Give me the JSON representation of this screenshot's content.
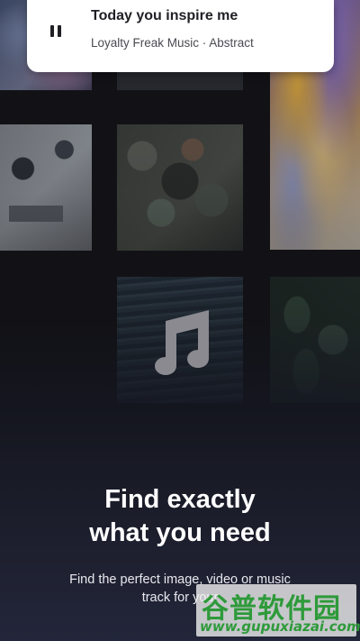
{
  "now_playing": {
    "title": "Today you inspire me",
    "subtitle": "Loyalty Freak Music · Abstract",
    "control_icon": "pause-icon"
  },
  "onboarding": {
    "headline_line1": "Find exactly",
    "headline_line2": "what you need",
    "description_line1": "Find the perfect image, video or music",
    "description_line2": "track for your"
  },
  "center_icon": "music-note-icon",
  "watermark": {
    "chinese_text": "谷普软件园",
    "url": "www.gupuxiazai.com"
  },
  "colors": {
    "background": "#121216",
    "card": "#ffffff",
    "headline": "#ffffff",
    "watermark_green": "#2e9a3a"
  }
}
